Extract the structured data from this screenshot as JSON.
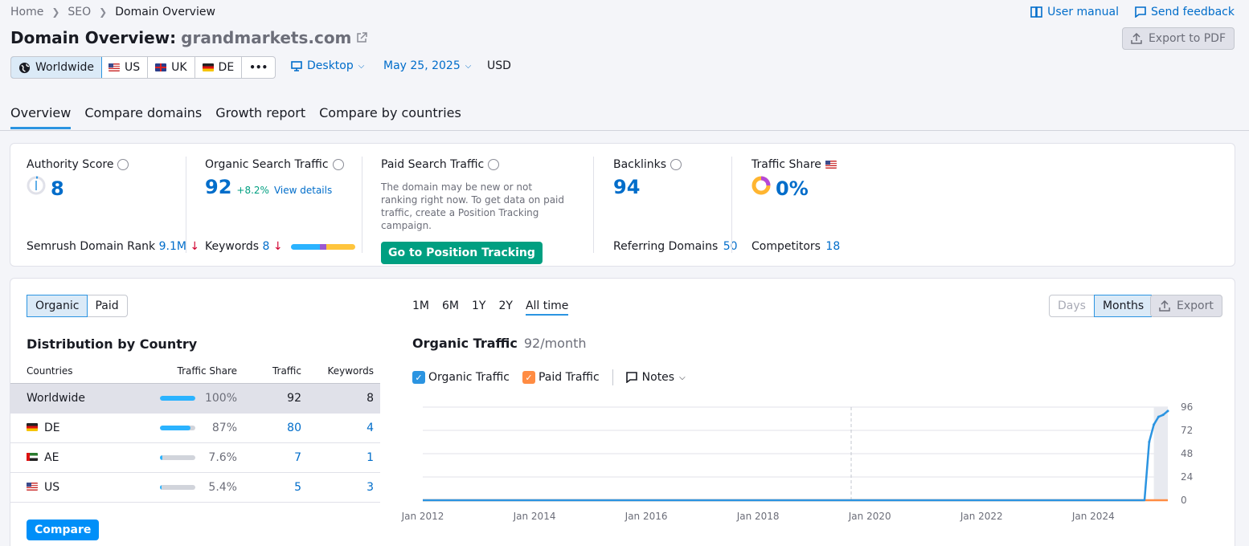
{
  "breadcrumb": {
    "items": [
      "Home",
      "SEO"
    ],
    "current": "Domain Overview"
  },
  "top_links": {
    "manual": "User manual",
    "feedback": "Send feedback"
  },
  "title": {
    "prefix": "Domain Overview:",
    "domain": "grandmarkets.com"
  },
  "export_pdf": "Export to PDF",
  "databases": [
    "Worldwide",
    "US",
    "UK",
    "DE"
  ],
  "more": "•••",
  "device": "Desktop",
  "date": "May 25, 2025",
  "currency": "USD",
  "tabs": [
    "Overview",
    "Compare domains",
    "Growth report",
    "Compare by countries"
  ],
  "metrics": {
    "authority": {
      "label": "Authority Score",
      "value": "8",
      "foot_label": "Semrush Domain Rank",
      "foot_value": "9.1M",
      "foot_arrow": "↓"
    },
    "organic": {
      "label": "Organic Search Traffic",
      "value": "92",
      "change": "+8.2%",
      "link": "View details",
      "foot_label": "Keywords",
      "foot_value": "8",
      "foot_arrow": "↓"
    },
    "paid": {
      "label": "Paid Search Traffic",
      "note": "The domain may be new or not ranking right now. To get data on paid traffic, create a Position Tracking campaign.",
      "button": "Go to Position Tracking"
    },
    "backlinks": {
      "label": "Backlinks",
      "value": "94",
      "foot_label": "Referring Domains",
      "foot_value": "50"
    },
    "traffic_share": {
      "label": "Traffic Share",
      "value": "0%",
      "foot_label": "Competitors",
      "foot_value": "18"
    }
  },
  "traffic_type": [
    "Organic",
    "Paid"
  ],
  "distribution": {
    "title": "Distribution by Country",
    "headers": [
      "Countries",
      "Traffic Share",
      "Traffic",
      "Keywords"
    ],
    "rows": [
      {
        "country": "Worldwide",
        "share": "100%",
        "share_frac": 1.0,
        "traffic": "92",
        "keywords": "8"
      },
      {
        "country": "DE",
        "share": "87%",
        "share_frac": 0.87,
        "traffic": "80",
        "keywords": "4"
      },
      {
        "country": "AE",
        "share": "7.6%",
        "share_frac": 0.076,
        "traffic": "7",
        "keywords": "1"
      },
      {
        "country": "US",
        "share": "5.4%",
        "share_frac": 0.054,
        "traffic": "5",
        "keywords": "3"
      }
    ],
    "compare_button": "Compare"
  },
  "periods": [
    "1M",
    "6M",
    "1Y",
    "2Y",
    "All time"
  ],
  "granularity": [
    "Days",
    "Months"
  ],
  "export": "Export",
  "chart_header": {
    "title": "Organic Traffic",
    "sub": "92/month"
  },
  "legend": {
    "organic": "Organic Traffic",
    "paid": "Paid Traffic",
    "notes": "Notes"
  },
  "colors": {
    "accent": "#006dca",
    "organic": "#2b94e1",
    "paid": "#ff8c43",
    "green": "#009f81"
  },
  "chart_data": {
    "type": "line",
    "title": "Organic Traffic",
    "x_tick_labels": [
      "Jan 2012",
      "Jan 2014",
      "Jan 2016",
      "Jan 2018",
      "Jan 2020",
      "Jan 2022",
      "Jan 2024"
    ],
    "y_tick_labels": [
      "0",
      "24",
      "48",
      "72",
      "96"
    ],
    "ylim": [
      0,
      96
    ],
    "xlim": [
      "2012-01",
      "2025-05"
    ],
    "series": [
      {
        "name": "Organic Traffic",
        "points": [
          [
            "2012-01",
            0
          ],
          [
            "2024-12",
            0
          ],
          [
            "2025-01",
            60
          ],
          [
            "2025-02",
            78
          ],
          [
            "2025-03",
            86
          ],
          [
            "2025-04",
            88
          ],
          [
            "2025-05",
            92
          ]
        ]
      },
      {
        "name": "Paid Traffic",
        "points": [
          [
            "2012-01",
            0
          ],
          [
            "2025-05",
            0
          ]
        ]
      }
    ]
  }
}
